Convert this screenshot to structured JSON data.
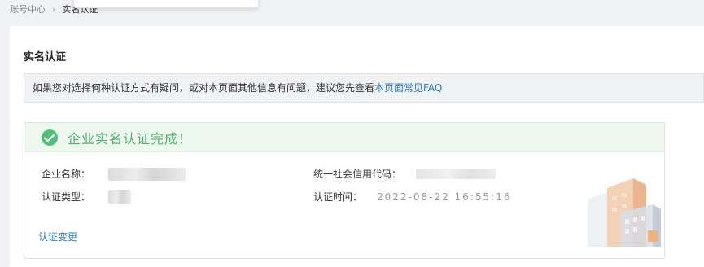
{
  "breadcrumb": {
    "parent": "账号中心",
    "separator": "›",
    "current": "实名认证"
  },
  "page": {
    "title": "实名认证"
  },
  "notice": {
    "text": "如果您对选择何种认证方式有疑问，或对本页面其他信息有问题，建议您先查看",
    "link": "本页面常见FAQ"
  },
  "result": {
    "status_title": "企业实名认证完成！",
    "fields": {
      "company_name_label": "企业名称：",
      "company_name_value": "",
      "cert_type_label": "认证类型：",
      "cert_type_value": "",
      "credit_code_label": "统一社会信用代码：",
      "credit_code_value": "",
      "cert_time_label": "认证时间：",
      "cert_time_value": "2022-08-22 16:55:16"
    },
    "change_link": "认证变更"
  },
  "colors": {
    "success_green": "#52c07a",
    "link_blue": "#2a7ad6",
    "success_bg": "#eef8ee",
    "notice_bg": "#f1f2f4"
  },
  "icons": {
    "status": "check-circle-icon",
    "illustration": "building-illustration"
  }
}
